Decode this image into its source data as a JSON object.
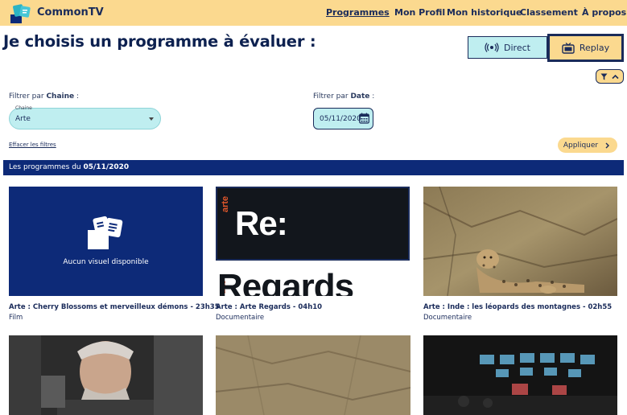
{
  "header": {
    "app_name": "CommonTV",
    "nav": [
      {
        "label": "Programmes",
        "active": true
      },
      {
        "label": "Mon Profil",
        "active": false
      },
      {
        "label": "Mon historique",
        "active": false
      },
      {
        "label": "Classement",
        "active": false
      },
      {
        "label": "À propos",
        "active": false
      }
    ]
  },
  "page": {
    "title": "Je choisis un programme à évaluer :",
    "modes": [
      {
        "label": "Direct",
        "icon": "broadcast-icon",
        "selected": false
      },
      {
        "label": "Replay",
        "icon": "tv-icon",
        "selected": true
      }
    ]
  },
  "filters": {
    "chaine_prefix": "Filtrer par ",
    "chaine_label": "Chaine",
    "chaine_suffix": " :",
    "chaine_caption": "Chaine",
    "chaine_value": "Arte",
    "date_prefix": "Filtrer par ",
    "date_label": "Date",
    "date_suffix": " :",
    "date_value": "05/11/2020",
    "clear_link": "Effacer les filtres",
    "apply_label": "Appliquer",
    "apply_icon": "chevron-right-icon"
  },
  "banner": {
    "prefix": "Les programmes du ",
    "date": "05/11/2020"
  },
  "programs": [
    {
      "title": "Arte : Cherry Blossoms et merveilleux démons - 23h35",
      "genre": "Film",
      "image": "placeholder",
      "placeholder_text": "Aucun visuel disponible"
    },
    {
      "title": "Arte : Arte Regards - 04h10",
      "genre": "Documentaire",
      "image": "arte-regards",
      "logo_top": "Re:",
      "logo_bottom": "Regards",
      "logo_vert": "arte"
    },
    {
      "title": "Arte : Inde : les léopards des montagnes - 02h55",
      "genre": "Documentaire",
      "image": "leopard-photo"
    },
    {
      "title": "",
      "genre": "",
      "image": "man-photo"
    },
    {
      "title": "",
      "genre": "",
      "image": "ground-photo"
    },
    {
      "title": "",
      "genre": "",
      "image": "control-room-photo"
    }
  ],
  "colors": {
    "header_bg": "#fbd98f",
    "navy": "#0d2a78",
    "text": "#1a2b5a",
    "cyan": "#bfeef0"
  }
}
